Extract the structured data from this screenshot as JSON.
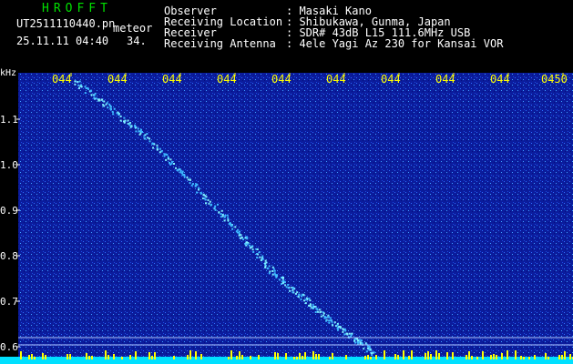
{
  "header": {
    "brand": "HROFFT",
    "filename": "UT2511110440.pn",
    "tag": "meteor",
    "datetime": "25.11.11 04:40",
    "number": "34."
  },
  "info": {
    "rows": [
      {
        "label": "Observer",
        "value": ": Masaki Kano"
      },
      {
        "label": "Receiving Location",
        "value": ": Shibukawa, Gunma, Japan"
      },
      {
        "label": "Receiver",
        "value": ": SDR# 43dB L15 111.6MHz USB"
      },
      {
        "label": "Receiving Antenna",
        "value": ": 4ele Yagi Az 230 for Kansai VOR"
      }
    ]
  },
  "axis": {
    "unit": "kHz",
    "y_ticks": [
      "1.1",
      "1.0",
      "0.9",
      "0.8",
      "0.7",
      "0.6"
    ],
    "x_ticks": [
      "044",
      "044",
      "044",
      "044",
      "044",
      "044",
      "044",
      "044",
      "044",
      "0450"
    ]
  },
  "colors": {
    "background": "#000000",
    "spectrogram": "#0a1a9a",
    "trail": "#5fe0ff",
    "baseline": "#00e0ff",
    "spikes": "#ffff00"
  }
}
